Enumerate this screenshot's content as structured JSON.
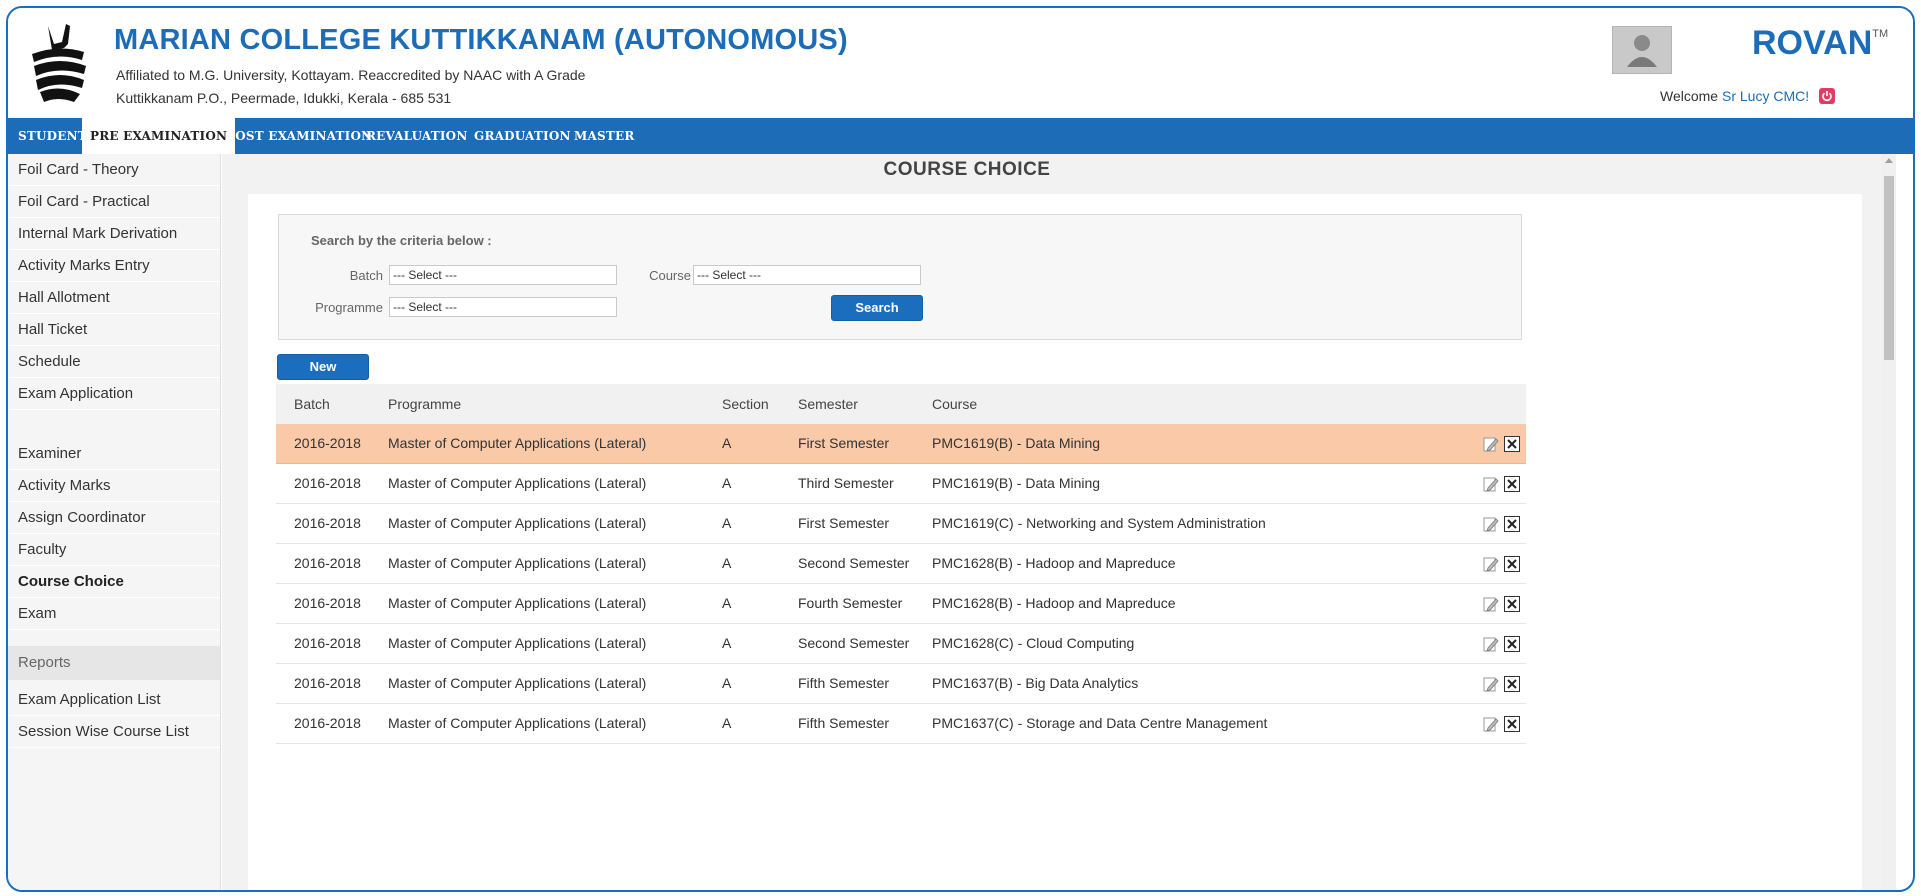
{
  "header": {
    "college_name": "MARIAN COLLEGE KUTTIKKANAM (AUTONOMOUS)",
    "affiliation": "Affiliated to M.G. University, Kottayam. Reaccredited by NAAC with A Grade",
    "address": "Kuttikkanam P.O., Peermade, Idukki, Kerala - 685 531",
    "brand": "ROVAN",
    "brand_tm": "TM",
    "welcome_prefix": "Welcome ",
    "user_name": "Sr Lucy CMC!"
  },
  "nav": {
    "items": [
      {
        "label": "STUDENT"
      },
      {
        "label": "PRE EXAMINATION"
      },
      {
        "label": "POST EXAMINATION"
      },
      {
        "label": "REVALUATION"
      },
      {
        "label": "GRADUATION"
      },
      {
        "label": "MASTER"
      }
    ],
    "active": "PRE EXAMINATION"
  },
  "sidebar": {
    "items": [
      {
        "label": "Foil Card - Theory"
      },
      {
        "label": "Foil Card - Practical"
      },
      {
        "label": "Internal Mark Derivation"
      },
      {
        "label": "Activity Marks Entry"
      },
      {
        "label": "Hall Allotment"
      },
      {
        "label": "Hall Ticket"
      },
      {
        "label": "Schedule"
      },
      {
        "label": "Exam Application"
      },
      {
        "label": "Examiner"
      },
      {
        "label": "Activity Marks"
      },
      {
        "label": "Assign Coordinator"
      },
      {
        "label": "Faculty"
      },
      {
        "label": "Course Choice"
      },
      {
        "label": "Exam"
      },
      {
        "label": "Exam Application List"
      },
      {
        "label": "Session Wise Course List"
      }
    ],
    "reports_heading": "Reports",
    "active": "Course Choice"
  },
  "page": {
    "title": "COURSE CHOICE",
    "search_legend": "Search by the criteria below :",
    "batch_label": "Batch",
    "batch_value": "--- Select ---",
    "course_label": "Course",
    "course_value": "--- Select ---",
    "programme_label": "Programme",
    "programme_value": "--- Select ---",
    "search_button": "Search",
    "new_button": "New"
  },
  "table": {
    "columns": [
      "Batch",
      "Programme",
      "Section",
      "Semester",
      "Course"
    ],
    "rows": [
      {
        "batch": "2016-2018",
        "programme": "Master of Computer Applications (Lateral)",
        "section": "A",
        "semester": "First Semester",
        "course": "PMC1619(B) - Data Mining"
      },
      {
        "batch": "2016-2018",
        "programme": "Master of Computer Applications (Lateral)",
        "section": "A",
        "semester": "Third Semester",
        "course": "PMC1619(B) - Data Mining"
      },
      {
        "batch": "2016-2018",
        "programme": "Master of Computer Applications (Lateral)",
        "section": "A",
        "semester": "First Semester",
        "course": "PMC1619(C) - Networking and System Administration"
      },
      {
        "batch": "2016-2018",
        "programme": "Master of Computer Applications (Lateral)",
        "section": "A",
        "semester": "Second Semester",
        "course": "PMC1628(B) - Hadoop and Mapreduce"
      },
      {
        "batch": "2016-2018",
        "programme": "Master of Computer Applications (Lateral)",
        "section": "A",
        "semester": "Fourth Semester",
        "course": "PMC1628(B) - Hadoop and Mapreduce"
      },
      {
        "batch": "2016-2018",
        "programme": "Master of Computer Applications (Lateral)",
        "section": "A",
        "semester": "Second Semester",
        "course": "PMC1628(C) - Cloud Computing"
      },
      {
        "batch": "2016-2018",
        "programme": "Master of Computer Applications (Lateral)",
        "section": "A",
        "semester": "Fifth Semester",
        "course": "PMC1637(B) - Big Data Analytics"
      },
      {
        "batch": "2016-2018",
        "programme": "Master of Computer Applications (Lateral)",
        "section": "A",
        "semester": "Fifth Semester",
        "course": "PMC1637(C) - Storage and Data Centre Management"
      }
    ],
    "highlighted_row": 0,
    "row_actions": [
      "edit-icon",
      "delete-icon"
    ]
  },
  "colors": {
    "primary": "#1d6cb7",
    "highlight_row": "#f9c9a8",
    "logout": "#e03c64"
  }
}
